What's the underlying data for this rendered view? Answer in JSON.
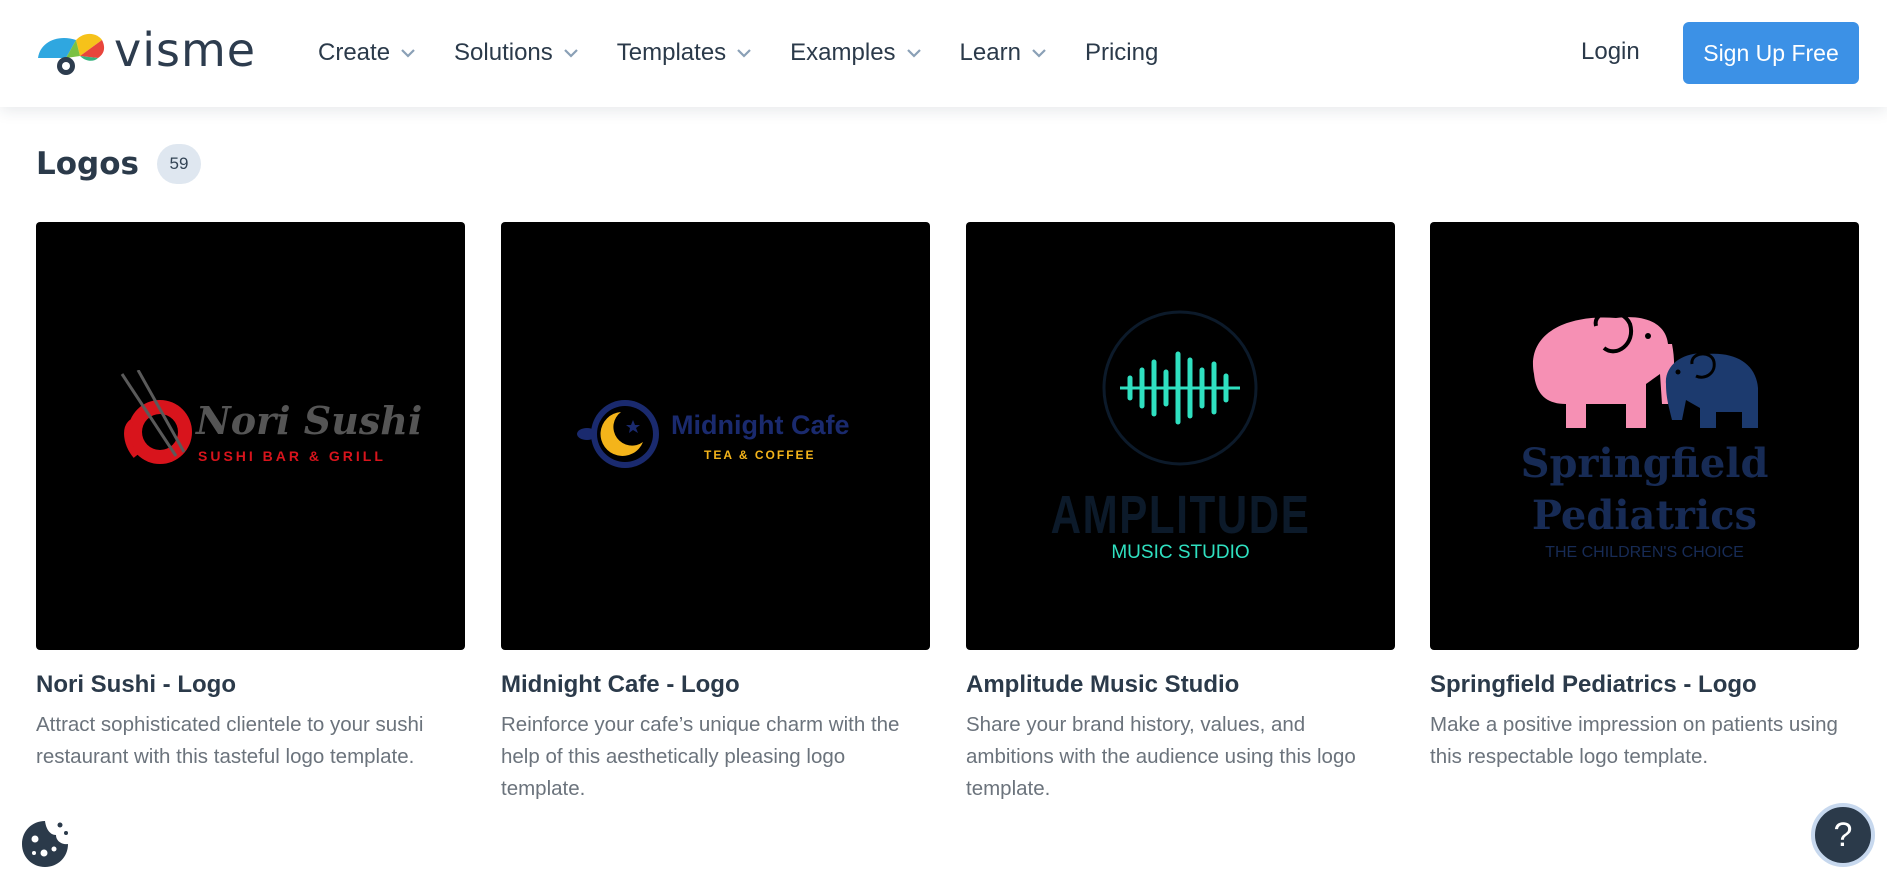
{
  "header": {
    "logo_text": "visme",
    "nav": [
      {
        "label": "Create",
        "has_dropdown": true
      },
      {
        "label": "Solutions",
        "has_dropdown": true
      },
      {
        "label": "Templates",
        "has_dropdown": true
      },
      {
        "label": "Examples",
        "has_dropdown": true
      },
      {
        "label": "Learn",
        "has_dropdown": true
      },
      {
        "label": "Pricing",
        "has_dropdown": false
      }
    ],
    "login_label": "Login",
    "signup_label": "Sign Up Free"
  },
  "section": {
    "title": "Logos",
    "count": "59"
  },
  "cards": [
    {
      "title": "Nori Sushi - Logo",
      "description": "Attract sophisticated clientele to your sushi restaurant with this tasteful logo template.",
      "logo": {
        "name": "Nori Sushi",
        "tagline": "SUSHI BAR & GRILL"
      }
    },
    {
      "title": "Midnight Cafe - Logo",
      "description": "Reinforce your cafe’s unique charm with the help of this aesthetically pleasing logo template.",
      "logo": {
        "name": "Midnight Cafe",
        "tagline": "TEA & COFFEE"
      }
    },
    {
      "title": "Amplitude Music Studio",
      "description": "Share your brand history, values, and ambitions with the audience using this logo template.",
      "logo": {
        "name": "AMPLITUDE",
        "tagline": "MUSIC STUDIO"
      }
    },
    {
      "title": "Springfield Pediatrics - Logo",
      "description": "Make a positive impression on patients using this respectable logo template.",
      "logo": {
        "name_line1": "Springfield",
        "name_line2": "Pediatrics",
        "tagline": "THE CHILDREN'S CHOICE"
      }
    }
  ],
  "floating": {
    "help_label": "?",
    "cookie_icon": "cookie-icon"
  },
  "colors": {
    "accent": "#3c91e6",
    "text_dark": "#2b3a4a",
    "text_muted": "#6b737c",
    "thumb_bg": "#000000"
  }
}
